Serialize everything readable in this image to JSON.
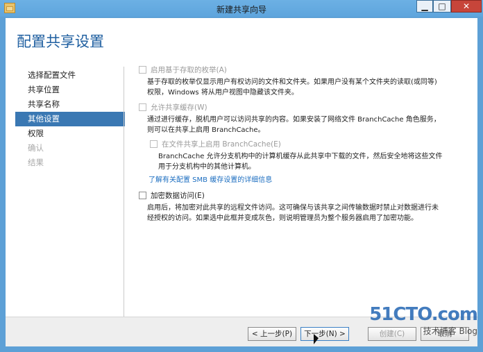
{
  "window": {
    "title": "新建共享向导",
    "min_label": "▁",
    "max_label": "□",
    "close_label": "✕"
  },
  "page": {
    "heading": "配置共享设置"
  },
  "nav": {
    "items": [
      {
        "label": "选择配置文件"
      },
      {
        "label": "共享位置"
      },
      {
        "label": "共享名称"
      },
      {
        "label": "其他设置"
      },
      {
        "label": "权限"
      },
      {
        "label": "确认"
      },
      {
        "label": "结果"
      }
    ]
  },
  "options": {
    "abe": {
      "label": "启用基于存取的枚举(A)",
      "checked": false,
      "desc1": "基于存取的枚举仅显示用户有权访问的文件和文件夹。如果用户没有某个文件夹的读取(或同等)",
      "desc2": "权限，Windows 将从用户视图中隐藏该文件夹。"
    },
    "cache": {
      "label": "允许共享缓存(W)",
      "checked": false,
      "desc1": "通过进行缓存，脱机用户可以访问共享的内容。如果安装了网络文件 BranchCache 角色服务，",
      "desc2": "则可以在共享上启用 BranchCache。"
    },
    "branchcache": {
      "label": "在文件共享上启用 BranchCache(E)",
      "checked": false,
      "desc1": "BranchCache 允许分支机构中的计算机缓存从此共享中下载的文件，然后安全地将这些文件",
      "desc2": "用于分支机构中的其他计算机。"
    },
    "smb_link": "了解有关配置 SMB 缓存设置的详细信息",
    "encrypt": {
      "label": "加密数据访问(E)",
      "checked": false,
      "desc1": "启用后，将加密对此共享的远程文件访问。这可确保与该共享之间传输数据时禁止对数据进行未",
      "desc2": "经授权的访问。如果选中此框并变成灰色，则说明管理员为整个服务器启用了加密功能。"
    }
  },
  "buttons": {
    "prev": "< 上一步(P)",
    "next": "下一步(N) >",
    "create": "创建(C)",
    "cancel": "取消"
  },
  "watermark": {
    "line1": "51CTO.com",
    "line2": "技术博客 Blog"
  }
}
